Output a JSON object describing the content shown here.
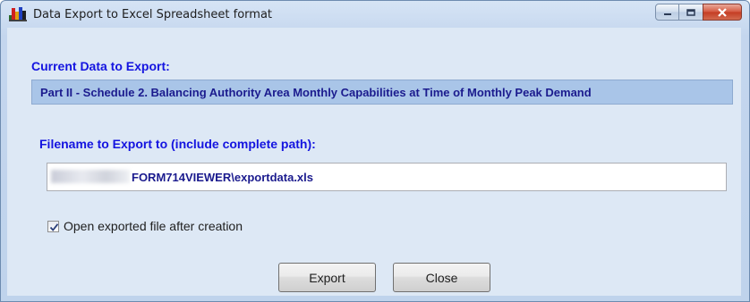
{
  "window": {
    "title": "Data Export to Excel Spreadsheet format",
    "icon": "excel-chart-app-icon",
    "caption_buttons": [
      "minimize-icon",
      "maximize-icon",
      "close-icon"
    ]
  },
  "current_data": {
    "label": "Current Data to Export:",
    "value": "Part II - Schedule 2.  Balancing Authority Area Monthly Capabilities at Time of Monthly Peak Demand"
  },
  "filename": {
    "label": "Filename to Export to (include complete path):",
    "value": "FORM714VIEWER\\exportdata.xls"
  },
  "options": {
    "open_after_label": "Open exported file after creation",
    "open_after_checked": true
  },
  "buttons": {
    "export_label": "Export",
    "close_label": "Close"
  },
  "colors": {
    "label_blue": "#1414e0",
    "value_text": "#1b1b8e",
    "highlight_box": "#a9c5e8",
    "client_bg": "#dde8f5"
  }
}
